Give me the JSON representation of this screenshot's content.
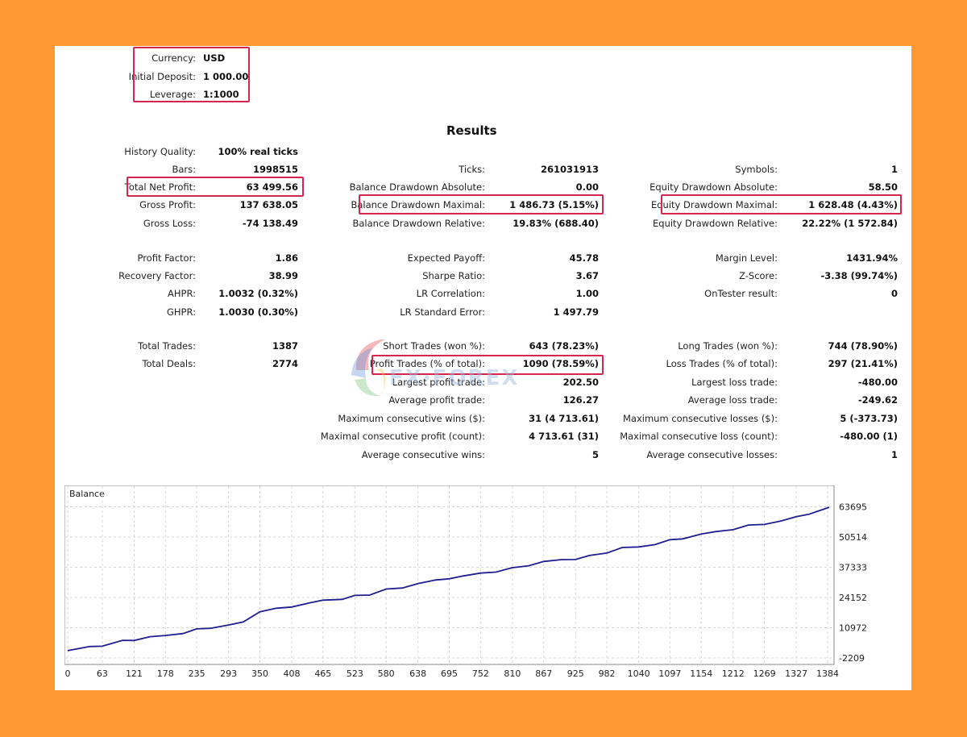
{
  "header": {
    "currency_label": "Currency:",
    "currency_value": "USD",
    "deposit_label": "Initial Deposit:",
    "deposit_value": "1 000.00",
    "leverage_label": "Leverage:",
    "leverage_value": "1:1000"
  },
  "title": "Results",
  "col1": [
    {
      "label": "History Quality:",
      "value": "100% real ticks"
    },
    {
      "label": "Bars:",
      "value": "1998515"
    },
    {
      "label": "Total Net Profit:",
      "value": "63 499.56"
    },
    {
      "label": "Gross Profit:",
      "value": "137 638.05"
    },
    {
      "label": "Gross Loss:",
      "value": "-74 138.49"
    },
    {
      "label": "Profit Factor:",
      "value": "1.86"
    },
    {
      "label": "Recovery Factor:",
      "value": "38.99"
    },
    {
      "label": "AHPR:",
      "value": "1.0032 (0.32%)"
    },
    {
      "label": "GHPR:",
      "value": "1.0030 (0.30%)"
    },
    {
      "label": "Total Trades:",
      "value": "1387"
    },
    {
      "label": "Total Deals:",
      "value": "2774"
    }
  ],
  "col2": [
    {
      "label": "Ticks:",
      "value": "261031913"
    },
    {
      "label": "Balance Drawdown Absolute:",
      "value": "0.00"
    },
    {
      "label": "Balance Drawdown Maximal:",
      "value": "1 486.73 (5.15%)"
    },
    {
      "label": "Balance Drawdown Relative:",
      "value": "19.83% (688.40)"
    },
    {
      "label": "Expected Payoff:",
      "value": "45.78"
    },
    {
      "label": "Sharpe Ratio:",
      "value": "3.67"
    },
    {
      "label": "LR Correlation:",
      "value": "1.00"
    },
    {
      "label": "LR Standard Error:",
      "value": "1 497.79"
    },
    {
      "label": "Short Trades (won %):",
      "value": "643 (78.23%)"
    },
    {
      "label": "Profit Trades (% of total):",
      "value": "1090 (78.59%)"
    },
    {
      "label": "Largest profit trade:",
      "value": "202.50"
    },
    {
      "label": "Average profit trade:",
      "value": "126.27"
    },
    {
      "label": "Maximum consecutive wins ($):",
      "value": "31 (4 713.61)"
    },
    {
      "label": "Maximal consecutive profit (count):",
      "value": "4 713.61 (31)"
    },
    {
      "label": "Average consecutive wins:",
      "value": "5"
    }
  ],
  "col3": [
    {
      "label": "Symbols:",
      "value": "1"
    },
    {
      "label": "Equity Drawdown Absolute:",
      "value": "58.50"
    },
    {
      "label": "Equity Drawdown Maximal:",
      "value": "1 628.48 (4.43%)"
    },
    {
      "label": "Equity Drawdown Relative:",
      "value": "22.22% (1 572.84)"
    },
    {
      "label": "Margin Level:",
      "value": "1431.94%"
    },
    {
      "label": "Z-Score:",
      "value": "-3.38 (99.74%)"
    },
    {
      "label": "OnTester result:",
      "value": "0"
    },
    {
      "label": "Long Trades (won %):",
      "value": "744 (78.90%)"
    },
    {
      "label": "Loss Trades (% of total):",
      "value": "297 (21.41%)"
    },
    {
      "label": "Largest loss trade:",
      "value": "-480.00"
    },
    {
      "label": "Average loss trade:",
      "value": "-249.62"
    },
    {
      "label": "Maximum consecutive losses ($):",
      "value": "5 (-373.73)"
    },
    {
      "label": "Maximal consecutive loss (count):",
      "value": "-480.00 (1)"
    },
    {
      "label": "Average consecutive losses:",
      "value": "1"
    }
  ],
  "watermark": {
    "text": "FX·FOREX"
  },
  "colors": {
    "background": "#FF9A33",
    "highlight": "#D7264E",
    "line": "#1F1F8F",
    "grid": "#D6D6D6"
  },
  "chart_data": {
    "type": "line",
    "title": "Balance",
    "x_ticks": [
      "0",
      "63",
      "121",
      "178",
      "235",
      "293",
      "350",
      "408",
      "465",
      "523",
      "580",
      "638",
      "695",
      "752",
      "810",
      "867",
      "925",
      "982",
      "1040",
      "1097",
      "1154",
      "1212",
      "1269",
      "1327",
      "1384"
    ],
    "y_ticks": [
      "63695",
      "50514",
      "37333",
      "24152",
      "10972",
      "-2209"
    ],
    "xlim": [
      0,
      1387
    ],
    "ylim": [
      -2209,
      66000
    ],
    "series": [
      {
        "x": [
          0,
          40,
          63,
          100,
          121,
          150,
          178,
          210,
          235,
          260,
          293,
          320,
          350,
          380,
          408,
          440,
          465,
          500,
          523,
          550,
          580,
          610,
          638,
          670,
          695,
          720,
          752,
          780,
          810,
          840,
          867,
          900,
          925,
          950,
          982,
          1010,
          1040,
          1070,
          1097,
          1120,
          1154,
          1180,
          1212,
          1240,
          1269,
          1300,
          1327,
          1350,
          1370,
          1387
        ],
        "y": [
          1000,
          2800,
          3500,
          5200,
          5700,
          6500,
          7600,
          9000,
          10200,
          11000,
          11600,
          13500,
          18500,
          19200,
          20300,
          21200,
          23000,
          23900,
          24800,
          25500,
          27300,
          28300,
          30800,
          31500,
          32600,
          33000,
          34800,
          35800,
          36900,
          38300,
          39300,
          40700,
          41300,
          42200,
          43800,
          45400,
          46200,
          47800,
          49100,
          50000,
          51300,
          52900,
          54300,
          55500,
          56300,
          57000,
          59400,
          61000,
          61800,
          63500
        ]
      }
    ]
  }
}
